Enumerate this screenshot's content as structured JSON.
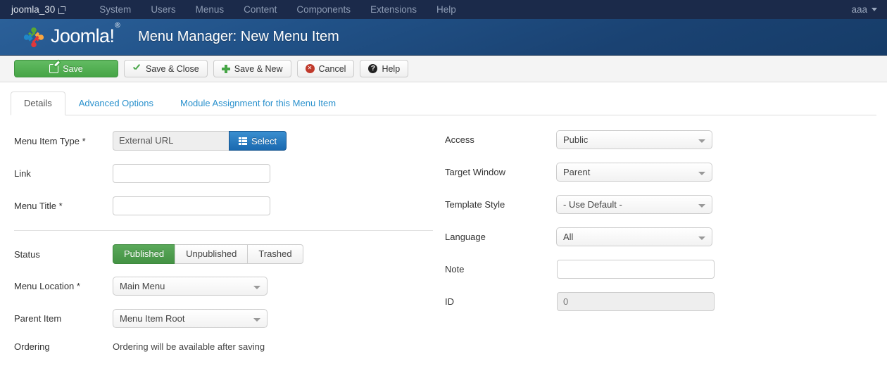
{
  "topbar": {
    "site_name": "joomla_30",
    "site_icon": "external-link-icon",
    "nav": [
      {
        "label": "System"
      },
      {
        "label": "Users"
      },
      {
        "label": "Menus"
      },
      {
        "label": "Content"
      },
      {
        "label": "Components"
      },
      {
        "label": "Extensions"
      },
      {
        "label": "Help"
      }
    ],
    "user": "aaa"
  },
  "header": {
    "brand": "Joomla!",
    "brand_mark": "joomla-logo-icon",
    "page_title": "Menu Manager: New Menu Item"
  },
  "toolbar": {
    "save": "Save",
    "save_close": "Save & Close",
    "save_new": "Save & New",
    "cancel": "Cancel",
    "help": "Help"
  },
  "tabs": [
    {
      "label": "Details",
      "active": true
    },
    {
      "label": "Advanced Options",
      "active": false
    },
    {
      "label": "Module Assignment for this Menu Item",
      "active": false
    }
  ],
  "form": {
    "left": {
      "menu_item_type_label": "Menu Item Type *",
      "menu_item_type_value": "External URL",
      "select_button": "Select",
      "link_label": "Link",
      "link_value": "",
      "menu_title_label": "Menu Title *",
      "menu_title_value": "",
      "status_label": "Status",
      "status_options": [
        "Published",
        "Unpublished",
        "Trashed"
      ],
      "status_selected": "Published",
      "menu_location_label": "Menu Location *",
      "menu_location_value": "Main Menu",
      "parent_item_label": "Parent Item",
      "parent_item_value": "Menu Item Root",
      "ordering_label": "Ordering",
      "ordering_value": "Ordering will be available after saving"
    },
    "right": {
      "access_label": "Access",
      "access_value": "Public",
      "target_window_label": "Target Window",
      "target_window_value": "Parent",
      "template_style_label": "Template Style",
      "template_style_value": "- Use Default -",
      "language_label": "Language",
      "language_value": "All",
      "note_label": "Note",
      "note_value": "",
      "id_label": "ID",
      "id_value": "0"
    }
  },
  "colors": {
    "topbar": "#1b2a4a",
    "header_blue": "#215288",
    "accent_green": "#46a546",
    "accent_blue": "#1a69b0",
    "link_blue": "#2a91cd"
  }
}
